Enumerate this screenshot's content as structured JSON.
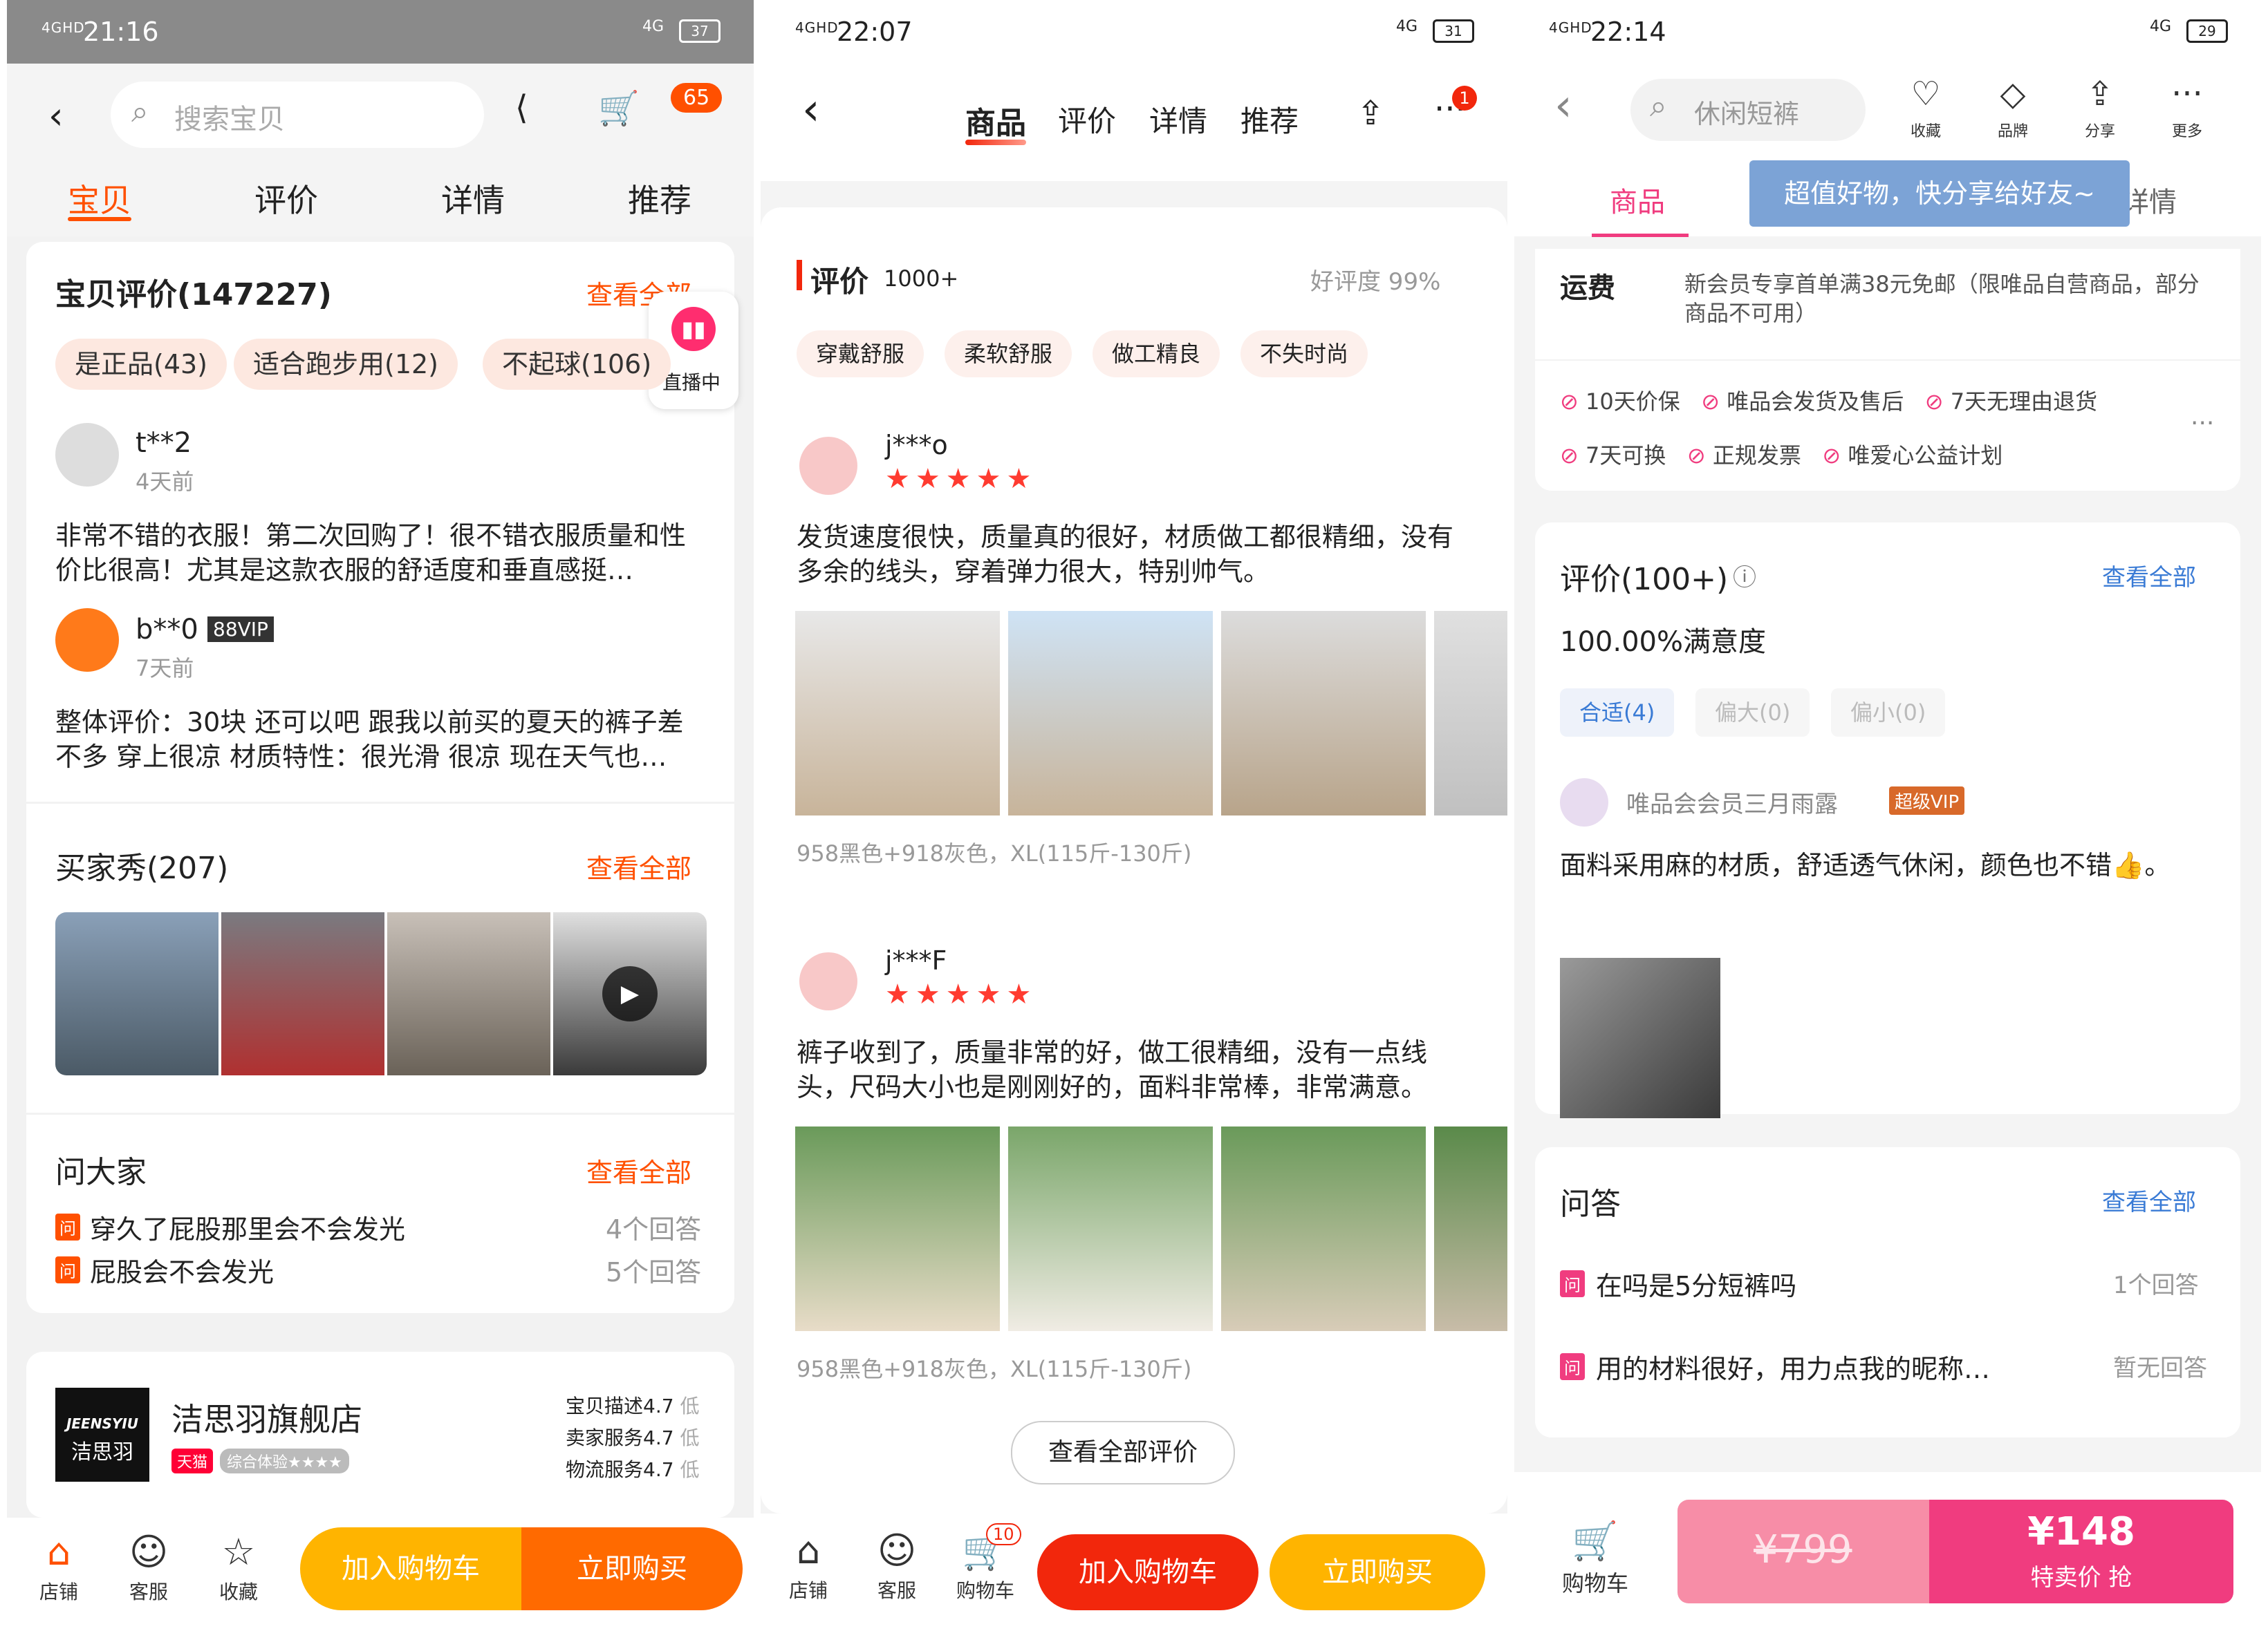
{
  "panel1": {
    "status": {
      "time": "21:16",
      "signal": "4GHD",
      "network": "4G",
      "battery": "37"
    },
    "search": {
      "placeholder": "搜索宝贝"
    },
    "cart_badge": "65",
    "tabs": [
      "宝贝",
      "评价",
      "详情",
      "推荐"
    ],
    "reviews": {
      "title": "宝贝评价(147227)",
      "view_all": "查看全部",
      "live_label": "直播中",
      "tags": [
        "是正品(43)",
        "适合跑步用(12)",
        "不起球(106)"
      ],
      "items": [
        {
          "user": "t**2",
          "time": "4天前",
          "text": "非常不错的衣服！第二次回购了！很不错衣服质量和性价比很高！尤其是这款衣服的舒适度和垂直感挺…"
        },
        {
          "user": "b**0",
          "badge": "88VIP",
          "time": "7天前",
          "text": "整体评价：30块 还可以吧 跟我以前买的夏天的裤子差不多 穿上很凉 材质特性：很光滑 很凉 现在天气也…"
        }
      ]
    },
    "buyer_show": {
      "title": "买家秀(207)",
      "view_all": "查看全部"
    },
    "qa": {
      "title": "问大家",
      "view_all": "查看全部",
      "tag": "问",
      "items": [
        {
          "q": "穿久了屁股那里会不会发光",
          "a": "4个回答"
        },
        {
          "q": "屁股会不会发光",
          "a": "5个回答"
        }
      ]
    },
    "shop": {
      "logo_top": "JEENSYIU",
      "logo_bottom": "洁思羽",
      "name": "洁思羽旗舰店",
      "tmall": "天猫",
      "experience": "综合体验",
      "experience_stars": "★★★★",
      "scores": [
        {
          "label": "宝贝描述",
          "value": "4.7",
          "level": "低"
        },
        {
          "label": "卖家服务",
          "value": "4.7",
          "level": "低"
        },
        {
          "label": "物流服务",
          "value": "4.7",
          "level": "低"
        }
      ]
    },
    "bottom": {
      "shop": "店铺",
      "service": "客服",
      "favorite": "收藏",
      "add_cart": "加入购物车",
      "buy": "立即购买"
    }
  },
  "panel2": {
    "status": {
      "time": "22:07",
      "signal": "4GHD",
      "network": "4G",
      "battery": "31"
    },
    "tabs": [
      "商品",
      "评价",
      "详情",
      "推荐"
    ],
    "more_badge": "1",
    "review": {
      "title": "评价",
      "count": "1000+",
      "rating": "好评度 99%",
      "tags": [
        "穿戴舒服",
        "柔软舒服",
        "做工精良",
        "不失时尚"
      ],
      "items": [
        {
          "user": "j***o",
          "stars": 5,
          "text": "发货速度很快，质量真的很好，材质做工都很精细，没有多余的线头，穿着弹力很大，特别帅气。",
          "sku": "958黑色+918灰色，XL(115斤-130斤)"
        },
        {
          "user": "j***F",
          "stars": 5,
          "text": "裤子收到了，质量非常的好，做工很精细，没有一点线头，尺码大小也是刚刚好的，面料非常棒，非常满意。",
          "sku": "958黑色+918灰色，XL(115斤-130斤)"
        }
      ],
      "view_all": "查看全部评价"
    },
    "bottom": {
      "shop": "店铺",
      "service": "客服",
      "cart": "购物车",
      "cart_badge": "10",
      "add_cart": "加入购物车",
      "buy": "立即购买"
    }
  },
  "panel3": {
    "status": {
      "time": "22:14",
      "signal": "4GHD",
      "network": "4G",
      "battery": "29"
    },
    "search": {
      "placeholder": "休闲短裤"
    },
    "actions": [
      "收藏",
      "品牌",
      "分享",
      "更多"
    ],
    "tabs": [
      "商品",
      "详情"
    ],
    "share_tip": "超值好物，快分享给好友~",
    "shipping": {
      "label": "运费",
      "text": "新会员专享首单满38元免邮（限唯品自营商品，部分商品不可用）"
    },
    "guarantees": [
      "10天价保",
      "唯品会发货及售后",
      "7天无理由退货",
      "7天可换",
      "正规发票",
      "唯爱心公益计划"
    ],
    "review": {
      "title": "评价(100+)",
      "view_all": "查看全部",
      "satisfaction": "100.00%满意度",
      "fit_tags": [
        "合适(4)",
        "偏大(0)",
        "偏小(0)"
      ],
      "user": "唯品会会员三月雨露",
      "vip": "超级VIP",
      "text": "面料采用麻的材质，舒适透气休闲，颜色也不错👍。"
    },
    "qa": {
      "title": "问答",
      "view_all": "查看全部",
      "tag": "问",
      "items": [
        {
          "q": "在吗是5分短裤吗",
          "a": "1个回答"
        },
        {
          "q": "用的材料很好，用力点我的昵称…",
          "a": "暂无回答"
        }
      ]
    },
    "bottom": {
      "cart": "购物车",
      "orig_price": "¥799",
      "price": "¥148",
      "cta": "特卖价 抢"
    }
  },
  "colors": {
    "taobao_orange": "#ff5000",
    "tmall_red": "#ff2d2d",
    "vip_pink": "#f03c7f",
    "vip_blue": "#3a7bd5"
  }
}
